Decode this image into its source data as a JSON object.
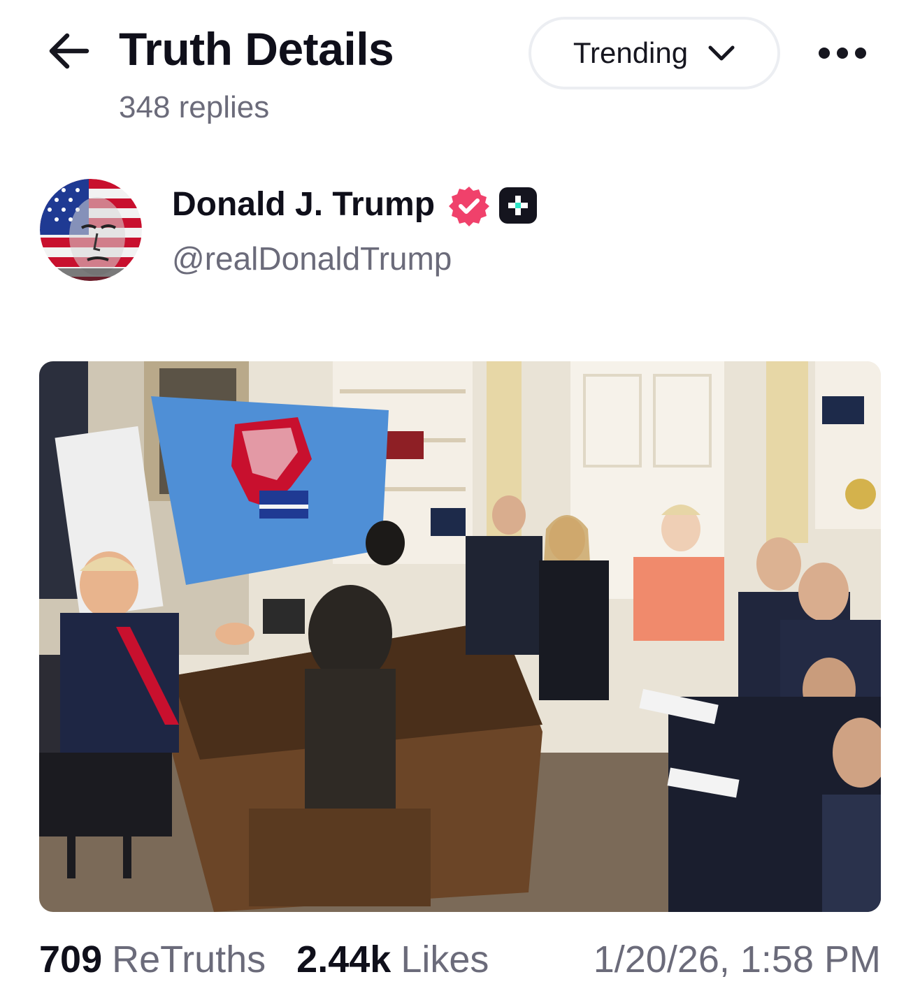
{
  "header": {
    "title": "Truth Details",
    "replies": "348 replies",
    "sort_label": "Trending",
    "back_icon": "arrow-left-icon",
    "sort_icon": "chevron-down-icon",
    "more_icon": "more-horizontal-icon"
  },
  "author": {
    "name": "Donald J. Trump",
    "handle": "@realDonaldTrump",
    "verified": true,
    "verified_color": "#f0416b",
    "plus_badge_color": "#14141e",
    "plus_accent_color": "#2ee6c8",
    "avatar_icon": "avatar-flag-portrait"
  },
  "post": {
    "media_type": "photo"
  },
  "stats": {
    "retruths_count": "709",
    "retruths_label": "ReTruths",
    "likes_count": "2.44k",
    "likes_label": "Likes",
    "timestamp": "1/20/26, 1:58 PM"
  }
}
